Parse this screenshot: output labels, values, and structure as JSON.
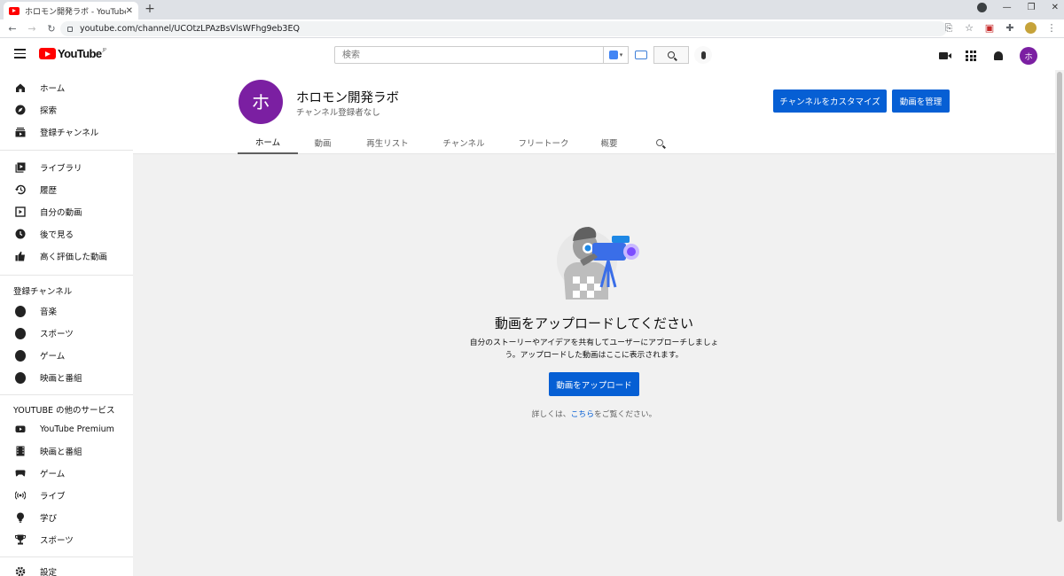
{
  "browser": {
    "tab_title": "ホロモン開発ラボ - YouTube",
    "tab_close": "✕",
    "new_tab": "+",
    "url": "youtube.com/channel/UCOtzLPAzBsVlsWFhg9eb3EQ"
  },
  "header": {
    "logo_text": "YouTube",
    "logo_region": "JP",
    "search_placeholder": "検索",
    "avatar_letter": "ホ"
  },
  "sidebar": {
    "main": [
      {
        "label": "ホーム",
        "icon": "home-icon"
      },
      {
        "label": "探索",
        "icon": "compass-icon"
      },
      {
        "label": "登録チャンネル",
        "icon": "subscriptions-icon"
      }
    ],
    "library": [
      {
        "label": "ライブラリ",
        "icon": "library-icon"
      },
      {
        "label": "履歴",
        "icon": "history-icon"
      },
      {
        "label": "自分の動画",
        "icon": "your-videos-icon"
      },
      {
        "label": "後で見る",
        "icon": "clock-icon"
      },
      {
        "label": "高く評価した動画",
        "icon": "thumbs-up-icon"
      }
    ],
    "subs_heading": "登録チャンネル",
    "subs": [
      {
        "label": "音楽",
        "icon": "music-channel-icon"
      },
      {
        "label": "スポーツ",
        "icon": "sports-channel-icon"
      },
      {
        "label": "ゲーム",
        "icon": "gaming-channel-icon"
      },
      {
        "label": "映画と番組",
        "icon": "movies-channel-icon"
      }
    ],
    "more_heading": "YOUTUBE の他のサービス",
    "more": [
      {
        "label": "YouTube Premium",
        "icon": "youtube-premium-icon"
      },
      {
        "label": "映画と番組",
        "icon": "film-icon"
      },
      {
        "label": "ゲーム",
        "icon": "gamepad-icon"
      },
      {
        "label": "ライブ",
        "icon": "live-icon"
      },
      {
        "label": "学び",
        "icon": "lightbulb-icon"
      },
      {
        "label": "スポーツ",
        "icon": "trophy-icon"
      }
    ],
    "settings": {
      "label": "設定",
      "icon": "gear-icon"
    }
  },
  "channel": {
    "avatar_letter": "ホ",
    "name": "ホロモン開発ラボ",
    "subscribers": "チャンネル登録者なし",
    "customize_button": "チャンネルをカスタマイズ",
    "manage_button": "動画を管理",
    "tabs": [
      "ホーム",
      "動画",
      "再生リスト",
      "チャンネル",
      "フリートーク",
      "概要"
    ],
    "active_tab": 0
  },
  "empty_state": {
    "title": "動画をアップロードしてください",
    "description": "自分のストーリーやアイデアを共有してユーザーにアプローチしましょう。アップロードした動画はここに表示されます。",
    "upload_button": "動画をアップロード",
    "footer_prefix": "詳しくは、",
    "footer_link": "こちら",
    "footer_suffix": "をご覧ください。"
  },
  "colors": {
    "accent": "#065fd4",
    "avatar": "#7b1fa2",
    "youtube_red": "#ff0000"
  }
}
